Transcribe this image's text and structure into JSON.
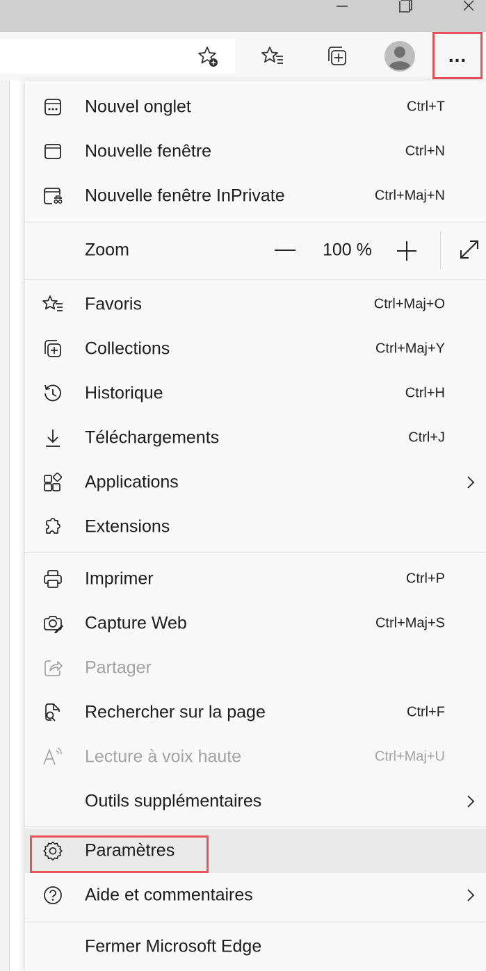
{
  "toolbar": {
    "add_favorite_icon": "star-plus-icon",
    "favorites_icon": "star-list-icon",
    "collections_icon": "collections-icon",
    "profile_icon": "avatar",
    "more_label": "..."
  },
  "menu": {
    "items": [
      {
        "label": "Nouvel onglet",
        "shortcut": "Ctrl+T",
        "icon": "new-tab-icon"
      },
      {
        "label": "Nouvelle fenêtre",
        "shortcut": "Ctrl+N",
        "icon": "new-window-icon"
      },
      {
        "label": "Nouvelle fenêtre InPrivate",
        "shortcut": "Ctrl+Maj+N",
        "icon": "inprivate-icon"
      },
      {
        "label": "Zoom",
        "value": "100 %"
      },
      {
        "label": "Favoris",
        "shortcut": "Ctrl+Maj+O",
        "icon": "favorites-icon"
      },
      {
        "label": "Collections",
        "shortcut": "Ctrl+Maj+Y",
        "icon": "collections-icon"
      },
      {
        "label": "Historique",
        "shortcut": "Ctrl+H",
        "icon": "history-icon"
      },
      {
        "label": "Téléchargements",
        "shortcut": "Ctrl+J",
        "icon": "download-icon"
      },
      {
        "label": "Applications",
        "icon": "apps-icon"
      },
      {
        "label": "Extensions",
        "icon": "extensions-icon"
      },
      {
        "label": "Imprimer",
        "shortcut": "Ctrl+P",
        "icon": "print-icon"
      },
      {
        "label": "Capture Web",
        "shortcut": "Ctrl+Maj+S",
        "icon": "web-capture-icon"
      },
      {
        "label": "Partager",
        "icon": "share-icon"
      },
      {
        "label": "Rechercher sur la page",
        "shortcut": "Ctrl+F",
        "icon": "find-icon"
      },
      {
        "label": "Lecture à voix haute",
        "shortcut": "Ctrl+Maj+U",
        "icon": "read-aloud-icon"
      },
      {
        "label": "Outils supplémentaires"
      },
      {
        "label": "Paramètres",
        "icon": "settings-icon"
      },
      {
        "label": "Aide et commentaires",
        "icon": "help-icon"
      },
      {
        "label": "Fermer Microsoft Edge"
      }
    ]
  },
  "colors": {
    "highlight": "#e8525a",
    "menu_bg": "#f9f9f9",
    "disabled_text": "#a3a3a3"
  }
}
